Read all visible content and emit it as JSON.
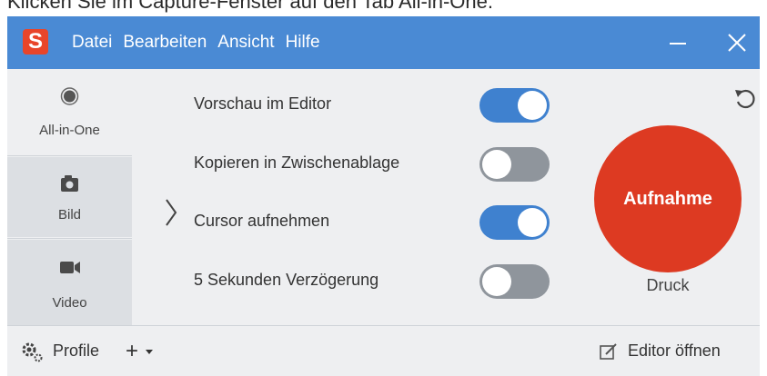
{
  "caption": {
    "text": "Klicken Sie im Capture-Fenster auf den Tab All-in-One."
  },
  "app": {
    "logo_letter": "S"
  },
  "menu": {
    "items": [
      "Datei",
      "Bearbeiten",
      "Ansicht",
      "Hilfe"
    ]
  },
  "sidebar": {
    "tabs": [
      {
        "label": "All-in-One",
        "icon": "record-icon",
        "selected": true
      },
      {
        "label": "Bild",
        "icon": "camera-icon",
        "selected": false
      },
      {
        "label": "Video",
        "icon": "video-camera-icon",
        "selected": false
      }
    ]
  },
  "settings": {
    "rows": [
      {
        "label": "Vorschau im Editor",
        "enabled": true
      },
      {
        "label": "Kopieren in Zwischenablage",
        "enabled": false
      },
      {
        "label": "Cursor aufnehmen",
        "enabled": true
      },
      {
        "label": "5 Sekunden Verzögerung",
        "enabled": false
      }
    ]
  },
  "capture": {
    "label": "Aufnahme",
    "hotkey": "Druck"
  },
  "footer": {
    "profile_label": "Profile",
    "add_label": "+",
    "editor_label": "Editor öffnen"
  },
  "colors": {
    "titlebar": "#4a8ad4",
    "toggle_on": "#3f81cf",
    "toggle_off": "#8f959c",
    "capture_button": "#dd3a22",
    "logo": "#e8452a"
  }
}
